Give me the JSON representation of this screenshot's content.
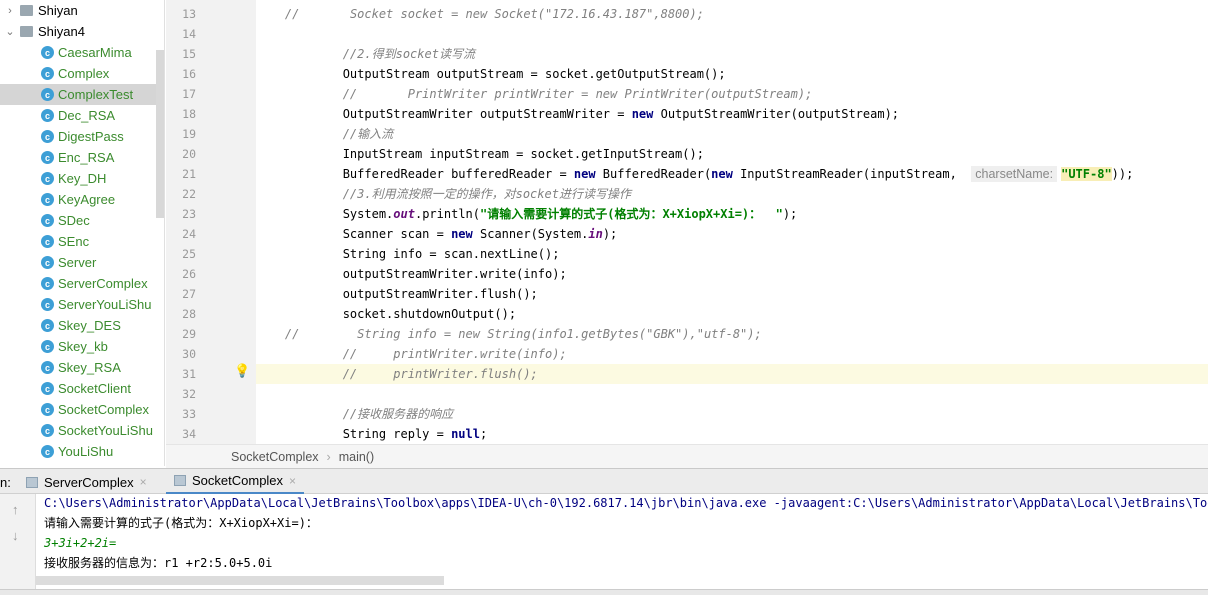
{
  "project_tree": {
    "folders": [
      {
        "label": "Shiyan",
        "expanded": false
      },
      {
        "label": "Shiyan4",
        "expanded": true
      }
    ],
    "classes": [
      "CaesarMima",
      "Complex",
      "ComplexTest",
      "Dec_RSA",
      "DigestPass",
      "Enc_RSA",
      "Key_DH",
      "KeyAgree",
      "SDec",
      "SEnc",
      "Server",
      "ServerComplex",
      "ServerYouLiShu",
      "Skey_DES",
      "Skey_kb",
      "Skey_RSA",
      "SocketClient",
      "SocketComplex",
      "SocketYouLiShu",
      "YouLiShu"
    ],
    "selected": "ComplexTest"
  },
  "editor": {
    "highlighted_line": 31,
    "lines": [
      {
        "n": 13,
        "seg": [
          [
            "//       ",
            "cmt"
          ],
          [
            "Socket socket = new Socket(\"172.16.43.187\",8800);",
            "cmt"
          ]
        ]
      },
      {
        "n": 14,
        "seg": []
      },
      {
        "n": 15,
        "seg": [
          [
            "        ",
            ""
          ],
          [
            "//2.得到socket读写流",
            "cmt"
          ]
        ]
      },
      {
        "n": 16,
        "seg": [
          [
            "        OutputStream outputStream = socket.getOutputStream();",
            ""
          ]
        ]
      },
      {
        "n": 17,
        "seg": [
          [
            "        ",
            ""
          ],
          [
            "//       PrintWriter printWriter = new PrintWriter(outputStream);",
            "cmt"
          ]
        ]
      },
      {
        "n": 18,
        "seg": [
          [
            "        OutputStreamWriter outputStreamWriter = ",
            ""
          ],
          [
            "new",
            "kw"
          ],
          [
            " OutputStreamWriter(outputStream);",
            ""
          ]
        ]
      },
      {
        "n": 19,
        "seg": [
          [
            "        ",
            ""
          ],
          [
            "//输入流",
            "cmt"
          ]
        ]
      },
      {
        "n": 20,
        "seg": [
          [
            "        InputStream inputStream = socket.getInputStream();",
            ""
          ]
        ]
      },
      {
        "n": 21,
        "seg": [
          [
            "        BufferedReader bufferedReader = ",
            ""
          ],
          [
            "new",
            "kw"
          ],
          [
            " BufferedReader(",
            ""
          ],
          [
            "new",
            "kw"
          ],
          [
            " InputStreamReader(inputStream,  ",
            ""
          ],
          [
            "charsetName:",
            "hint"
          ],
          [
            "\"UTF-8\"",
            "strhl"
          ],
          [
            "));",
            ""
          ]
        ]
      },
      {
        "n": 22,
        "seg": [
          [
            "        ",
            ""
          ],
          [
            "//3.利用流按照一定的操作，对socket进行读写操作",
            "cmt"
          ]
        ]
      },
      {
        "n": 23,
        "seg": [
          [
            "        System.",
            ""
          ],
          [
            "out",
            "fld"
          ],
          [
            ".println(",
            ""
          ],
          [
            "\"请输入需要计算的式子(格式为：X+XiopX+Xi=)：  \"",
            "str"
          ],
          [
            ");",
            ""
          ]
        ]
      },
      {
        "n": 24,
        "seg": [
          [
            "        Scanner scan = ",
            ""
          ],
          [
            "new",
            "kw"
          ],
          [
            " Scanner(System.",
            ""
          ],
          [
            "in",
            "fld"
          ],
          [
            ");",
            ""
          ]
        ]
      },
      {
        "n": 25,
        "seg": [
          [
            "        String info = scan.nextLine();",
            ""
          ]
        ]
      },
      {
        "n": 26,
        "seg": [
          [
            "        outputStreamWriter.write(info);",
            ""
          ]
        ]
      },
      {
        "n": 27,
        "seg": [
          [
            "        outputStreamWriter.flush();",
            ""
          ]
        ]
      },
      {
        "n": 28,
        "seg": [
          [
            "        socket.shutdownOutput();",
            ""
          ]
        ]
      },
      {
        "n": 29,
        "seg": [
          [
            "//        ",
            "cmt"
          ],
          [
            "String info = new String(info1.getBytes(\"GBK\"),\"utf-8\");",
            "cmt"
          ]
        ]
      },
      {
        "n": 30,
        "seg": [
          [
            "        ",
            ""
          ],
          [
            "//     printWriter.write(info);",
            "cmt"
          ]
        ]
      },
      {
        "n": 31,
        "seg": [
          [
            "        ",
            ""
          ],
          [
            "//     printWriter.flush();",
            "cmt"
          ]
        ]
      },
      {
        "n": 32,
        "seg": []
      },
      {
        "n": 33,
        "seg": [
          [
            "        ",
            ""
          ],
          [
            "//接收服务器的响应",
            "cmt"
          ]
        ]
      },
      {
        "n": 34,
        "seg": [
          [
            "        String reply = ",
            ""
          ],
          [
            "null",
            "kw"
          ],
          [
            ";",
            ""
          ]
        ]
      }
    ]
  },
  "breadcrumb": {
    "class": "SocketComplex",
    "method": "main()",
    "separator": "›"
  },
  "run_panel": {
    "prefix": "n:",
    "tabs": [
      {
        "label": "ServerComplex",
        "active": false
      },
      {
        "label": "SocketComplex",
        "active": true
      }
    ],
    "close": "×",
    "output": [
      {
        "text": "C:\\Users\\Administrator\\AppData\\Local\\JetBrains\\Toolbox\\apps\\IDEA-U\\ch-0\\192.6817.14\\jbr\\bin\\java.exe -javaagent:C:\\Users\\Administrator\\AppData\\Local\\JetBrains\\Toolbox",
        "kind": "cmd"
      },
      {
        "text": "请输入需要计算的式子(格式为：X+XiopX+Xi=)：",
        "kind": "out"
      },
      {
        "text": "3+3i+2+2i=",
        "kind": "input"
      },
      {
        "text": "接收服务器的信息为：r1 +r2:5.0+5.0i",
        "kind": "out"
      }
    ]
  },
  "colors": {
    "accent": "#4a88c7",
    "class_name": "#3b8b2e",
    "keyword": "#000080",
    "string": "#008000",
    "comment": "#808080",
    "cmd": "#000080",
    "input": "#008000"
  }
}
